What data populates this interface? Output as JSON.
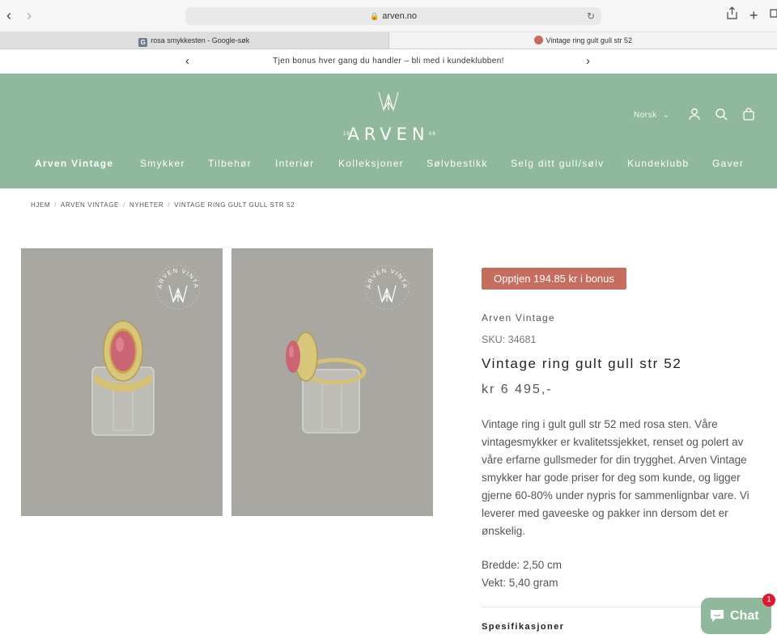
{
  "browser": {
    "url": "arven.no",
    "tabs": [
      {
        "label": "rosa smykkesten - Google-søk",
        "favicon": "G"
      },
      {
        "label": "Vintage ring gult gull str 52"
      }
    ]
  },
  "announcement": {
    "text": "Tjen bonus hver gang du handler – bli med i kundeklubben!"
  },
  "header": {
    "logo": "ARVEN",
    "logo_left": "18",
    "logo_right": "68",
    "language": "Norsk",
    "nav": [
      "Arven Vintage",
      "Smykker",
      "Tilbehør",
      "Interiør",
      "Kolleksjoner",
      "Sølvbestikk",
      "Selg ditt gull/sølv",
      "Kundeklubb",
      "Gaver"
    ]
  },
  "breadcrumb": [
    "HJEM",
    "ARVEN VINTAGE",
    "NYHETER",
    "VINTAGE RING GULT GULL STR 52"
  ],
  "gallery": {
    "stamp_text": "ARVEN VINTAGE"
  },
  "product": {
    "bonus_badge": "Opptjen 194.85 kr i bonus",
    "vendor": "Arven Vintage",
    "sku": "SKU: 34681",
    "title": "Vintage ring gult gull str 52",
    "price": "kr 6 495,-",
    "description": "Vintage ring i gult gull str 52 med rosa sten. Våre vintagesmykker er kvalitetssjekket, renset og polert av våre erfarne gullsmeder for din trygghet. Arven Vintage smykker har gode priser for deg som kunde, og ligger gjerne 60-80% under nypris for sammenlignbar vare. Vi leverer med gaveeske og pakker inn dersom det er ønskelig.",
    "width": "Bredde: 2,50 cm",
    "weight": "Vekt: 5,40 gram",
    "specs_heading": "Spesifikasjoner"
  },
  "chat": {
    "label": "Chat",
    "badge": "1"
  },
  "colors": {
    "header_bg": "#8fb89c",
    "badge_bg": "#c76d60",
    "photo_bg": "#a8a7a1"
  }
}
